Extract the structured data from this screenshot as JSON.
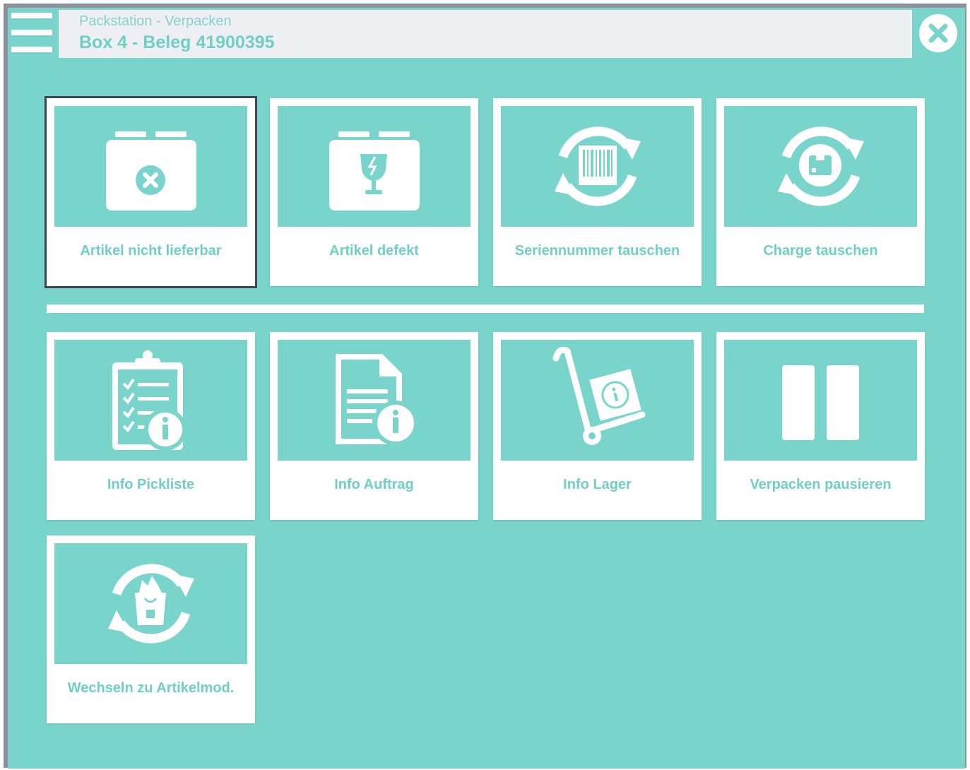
{
  "header": {
    "subtitle": "Packstation - Verpacken",
    "title": "Box 4 - Beleg 41900395"
  },
  "icons": {
    "menu": "hamburger-menu-icon",
    "close": "close-circle-icon"
  },
  "colors": {
    "accent": "#79d5cc",
    "tile": "#ffffff",
    "label": "#6fcfc5",
    "frame": "#8d9198",
    "selected_outline": "#3e4554"
  },
  "tiles_row1": [
    {
      "label": "Artikel nicht lieferbar",
      "icon": "box-cancel-icon",
      "selected": true
    },
    {
      "label": "Artikel defekt",
      "icon": "box-fragile-icon"
    },
    {
      "label": "Seriennummer tauschen",
      "icon": "barcode-swap-icon"
    },
    {
      "label": "Charge tauschen",
      "icon": "package-swap-icon"
    }
  ],
  "tiles_row2": [
    {
      "label": "Info Pickliste",
      "icon": "clipboard-info-icon"
    },
    {
      "label": "Info Auftrag",
      "icon": "document-info-icon"
    },
    {
      "label": "Info Lager",
      "icon": "handtruck-info-icon"
    },
    {
      "label": "Verpacken pausieren",
      "icon": "pause-icon"
    }
  ],
  "tiles_row3": [
    {
      "label": "Wechseln zu Artikelmod.",
      "icon": "bag-swap-icon"
    }
  ]
}
